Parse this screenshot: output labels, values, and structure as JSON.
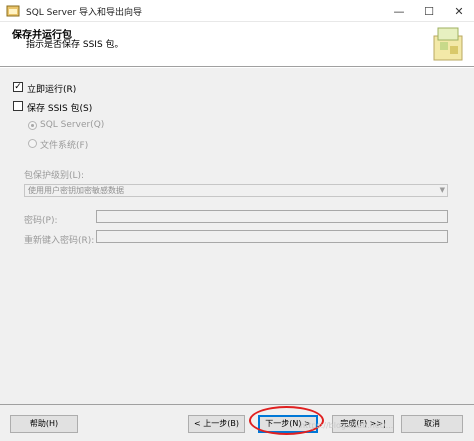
{
  "window": {
    "title": "SQL Server 导入和导出向导",
    "minimize_glyph": "—",
    "maximize_glyph": "☐",
    "close_glyph": "✕"
  },
  "header": {
    "title": "保存并运行包",
    "subtitle": "指示是否保存 SSIS 包。"
  },
  "options": {
    "run_immediately": {
      "label": "立即运行(R)",
      "checked": true,
      "check_glyph": "✓"
    },
    "save_ssis": {
      "label": "保存 SSIS 包(S)",
      "checked": false
    },
    "sql_server": {
      "label": "SQL Server(Q)",
      "selected": true
    },
    "file_system": {
      "label": "文件系统(F)",
      "selected": false
    }
  },
  "protection": {
    "label": "包保护级别(L):",
    "value": "使用用户密钥加密敏感数据",
    "arrow_glyph": "▼"
  },
  "password": {
    "label": "密码(P):",
    "value": ""
  },
  "reenter_password": {
    "label": "重新键入密码(R):",
    "value": ""
  },
  "buttons": {
    "help": "帮助(H)",
    "back": "< 上一步(B)",
    "next": "下一步(N) >",
    "finish": "完成(F) >>|",
    "cancel": "取消"
  },
  "watermark": "https://blog.csdn.net/..."
}
